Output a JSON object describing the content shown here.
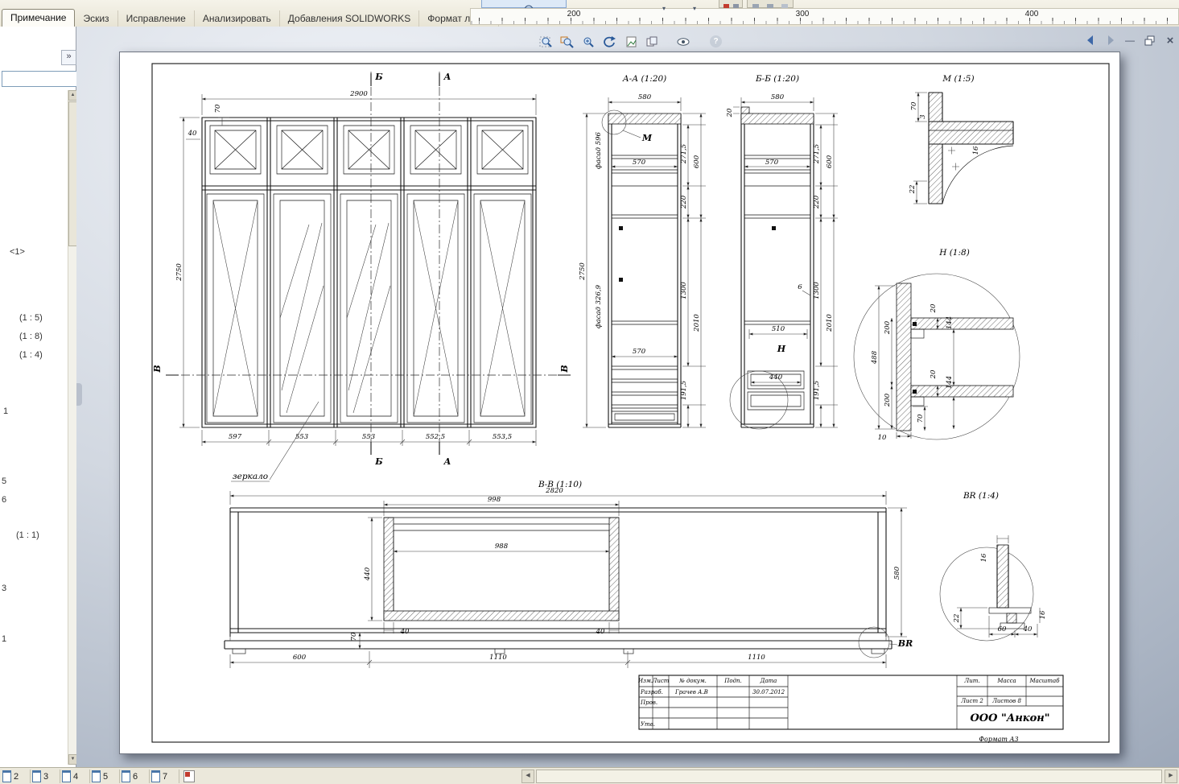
{
  "commandbar": {
    "tabs": [
      {
        "label": "Примечание",
        "active": true
      },
      {
        "label": "Эскиз",
        "active": false
      },
      {
        "label": "Исправление",
        "active": false
      },
      {
        "label": "Анализировать",
        "active": false
      },
      {
        "label": "Добавления SOLIDWORKS",
        "active": false
      },
      {
        "label": "Формат листа",
        "active": false
      }
    ]
  },
  "ruler": {
    "marks": [
      {
        "label": "200"
      },
      {
        "label": "300"
      },
      {
        "label": "400"
      }
    ]
  },
  "sidebar": {
    "collapse_glyph": "»",
    "items": [
      {
        "label": "<1>"
      },
      {
        "label": "(1 : 5)"
      },
      {
        "label": "(1 : 8)"
      },
      {
        "label": "(1 : 4)"
      },
      {
        "label": "1"
      },
      {
        "label": "5"
      },
      {
        "label": "6"
      },
      {
        "label": "(1 : 1)"
      },
      {
        "label": "3"
      },
      {
        "label": "1"
      }
    ]
  },
  "viewport_toolbar": {
    "help": "?",
    "dropdown": "▾"
  },
  "window_controls": {
    "minimize": "—",
    "close": "×"
  },
  "scrollbar": {
    "up": "▲",
    "down": "▼",
    "left": "◀",
    "right": "▶"
  },
  "sheet_tabs": {
    "items": [
      {
        "label": "2"
      },
      {
        "label": "3"
      },
      {
        "label": "4"
      },
      {
        "label": "5"
      },
      {
        "label": "6"
      },
      {
        "label": "7"
      }
    ]
  },
  "drawing": {
    "front": {
      "dim_width": "2900",
      "dim_height": "2750",
      "dim_top": "70",
      "dim_40": "40",
      "bottom_dims": [
        {
          "v": "597"
        },
        {
          "v": "553"
        },
        {
          "v": "553"
        },
        {
          "v": "552,5"
        },
        {
          "v": "553,5"
        }
      ],
      "sec_a": "А",
      "sec_b": "Б",
      "sec_v": "В",
      "mirror": "зеркало"
    },
    "aa": {
      "title": "А-А (1:20)",
      "d580": "580",
      "d570a": "570",
      "d570b": "570",
      "d2750": "2750",
      "facade1": "фасад 596",
      "facade2": "фасад 326,9",
      "d271": "271,5",
      "d600": "600",
      "d220": "220",
      "d1300": "1300",
      "d2010": "2010",
      "d191": "191,5",
      "mark": "М"
    },
    "bb": {
      "title": "Б-Б (1:20)",
      "d580": "580",
      "d20": "20",
      "d570": "570",
      "d271": "271,5",
      "d600": "600",
      "d220": "220",
      "d1300": "1300",
      "d2010": "2010",
      "d191": "191,5",
      "d6": "6",
      "d510": "510",
      "d440": "440",
      "mark": "Н"
    },
    "m": {
      "title": "М (1:5)",
      "d70": "70",
      "d3": "3",
      "d16": "16",
      "d22": "22"
    },
    "h": {
      "title": "Н (1:8)",
      "d488": "488",
      "d200a": "200",
      "d200b": "200",
      "d20a": "20",
      "d144a": "144",
      "d20b": "20",
      "d144b": "144",
      "d70": "70",
      "d10": "10"
    },
    "vv": {
      "title": "В-В (1:10)",
      "d2820": "2820",
      "d998": "998",
      "d988": "988",
      "d440": "440",
      "d70": "70",
      "d40a": "40",
      "d40b": "40",
      "d600": "600",
      "d1110a": "1110",
      "d1110b": "1110",
      "d580": "580",
      "mark": "BR"
    },
    "br": {
      "title": "BR (1:4)",
      "d16a": "16",
      "d22": "22",
      "d60": "60",
      "d40": "40",
      "d16b": "16"
    },
    "titleblock": {
      "izm": "Изм.",
      "list": "Лист",
      "doc": "№ докум.",
      "podp": "Подп.",
      "data": "Дата",
      "razrab": "Разраб.",
      "prov": "Пров.",
      "utv": "Утв.",
      "name": "Грачев А.В",
      "date": "30.07.2012",
      "lit": "Лит.",
      "mass": "Масса",
      "scale": "Масштаб",
      "sheet": "Лист 2",
      "sheets": "Листов 8",
      "company": "ООО \"Анкон\"",
      "format": "Формат  А3"
    }
  }
}
